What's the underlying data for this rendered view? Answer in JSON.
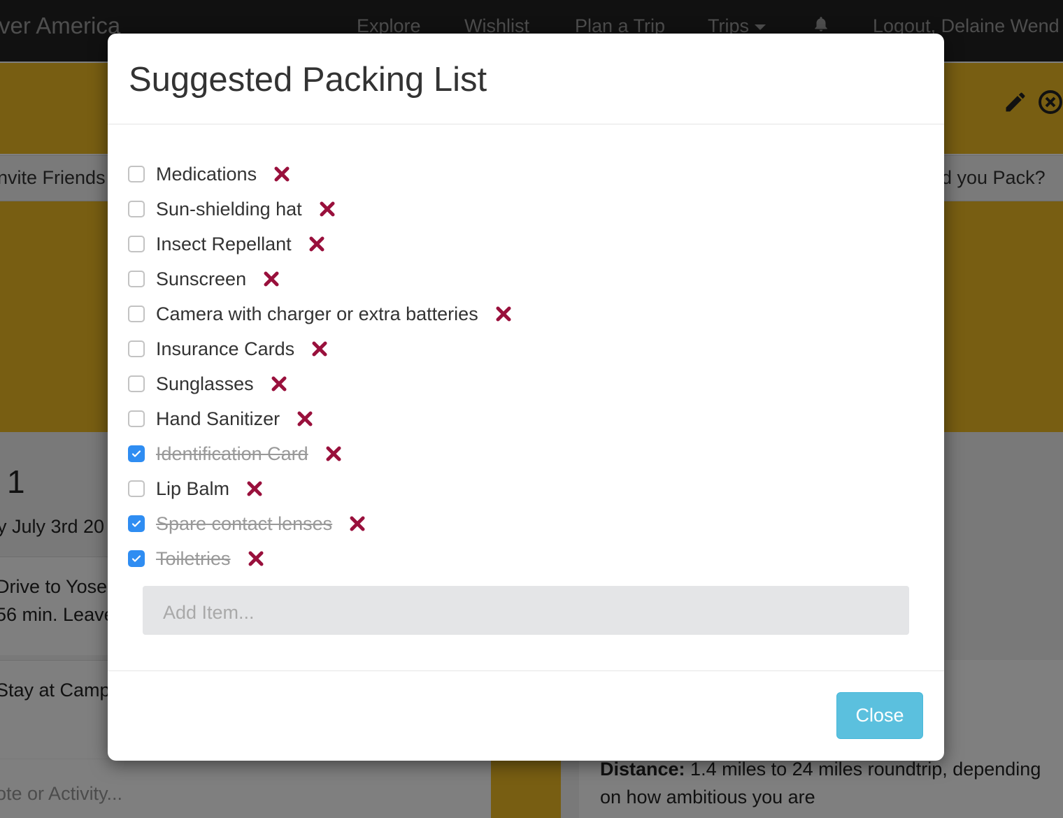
{
  "navbar": {
    "brand": "ver America",
    "links": [
      "Explore",
      "Wishlist",
      "Plan a Trip",
      "Trips"
    ],
    "user": "Logout, Delaine Wend"
  },
  "tabs": {
    "left": "nvite Friends",
    "right": "d you Pack?"
  },
  "day": {
    "number": "1",
    "date": "y July 3rd 20"
  },
  "cards": {
    "drive_line1": "Drive to Yoser",
    "drive_line2": "56 min. Leave",
    "stay": "Stay at Camp",
    "note_placeholder": "ote or Activity..."
  },
  "detail": {
    "distance_label": "Distance:",
    "distance_value": " 1.4 miles to 24 miles roundtrip, depending",
    "distance_line2": "on how ambitious you are"
  },
  "modal": {
    "title": "Suggested Packing List",
    "items": [
      {
        "label": "Medications",
        "checked": false
      },
      {
        "label": "Sun-shielding hat",
        "checked": false
      },
      {
        "label": "Insect Repellant",
        "checked": false
      },
      {
        "label": "Sunscreen",
        "checked": false
      },
      {
        "label": "Camera with charger or extra batteries",
        "checked": false
      },
      {
        "label": "Insurance Cards",
        "checked": false
      },
      {
        "label": "Sunglasses",
        "checked": false
      },
      {
        "label": "Hand Sanitizer",
        "checked": false
      },
      {
        "label": "Identification Card",
        "checked": true
      },
      {
        "label": "Lip Balm",
        "checked": false
      },
      {
        "label": "Spare contact lenses",
        "checked": true
      },
      {
        "label": "Toiletries",
        "checked": true
      }
    ],
    "add_placeholder": "Add Item...",
    "close_label": "Close"
  },
  "colors": {
    "accent_yellow": "#f0bd24",
    "delete_icon": "#99103c",
    "checkbox_checked": "#2f8df2",
    "close_button": "#5bc0de"
  },
  "icons": {
    "delete": "x-mark-icon",
    "bell": "bell-icon",
    "edit": "pencil-icon",
    "remove": "circle-x-icon"
  }
}
